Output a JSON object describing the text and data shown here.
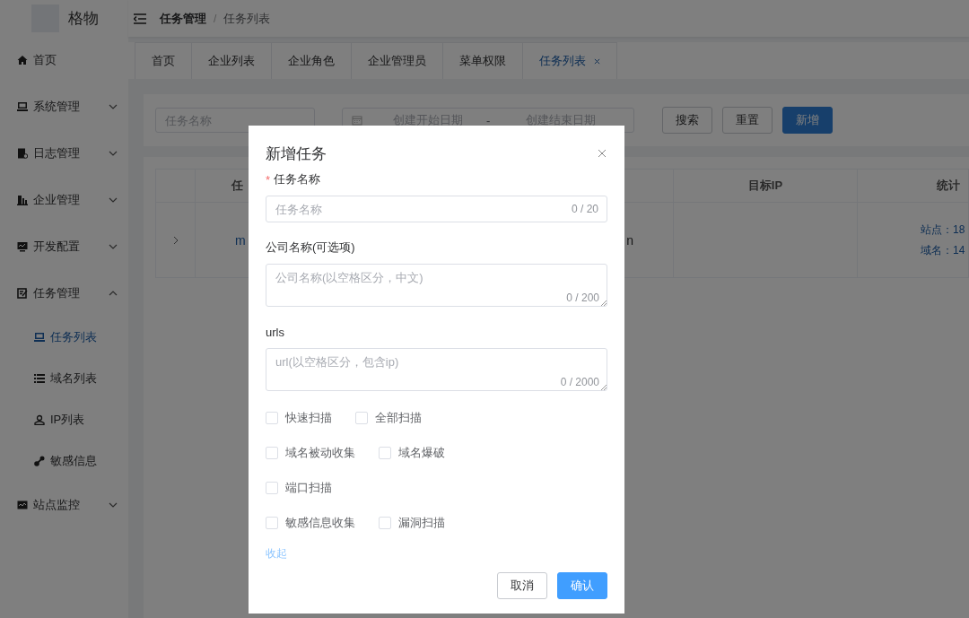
{
  "app": {
    "logo_text": "格物"
  },
  "breadcrumb": {
    "items": [
      "任务管理",
      "任务列表"
    ],
    "separator": "/"
  },
  "sidebar": {
    "items": [
      {
        "label": "首页",
        "kind": "link",
        "selected": false
      },
      {
        "label": "系统管理",
        "kind": "submenu",
        "expanded": false,
        "selected": false
      },
      {
        "label": "日志管理",
        "kind": "submenu",
        "expanded": false,
        "selected": false
      },
      {
        "label": "企业管理",
        "kind": "submenu",
        "expanded": false,
        "selected": false
      },
      {
        "label": "开发配置",
        "kind": "submenu",
        "expanded": false,
        "selected": false
      },
      {
        "label": "任务管理",
        "kind": "submenu",
        "expanded": true,
        "selected": false,
        "children": [
          {
            "label": "任务列表",
            "selected": true
          },
          {
            "label": "域名列表",
            "selected": false
          },
          {
            "label": "IP列表",
            "selected": false
          },
          {
            "label": "敏感信息",
            "selected": false
          }
        ]
      },
      {
        "label": "站点监控",
        "kind": "submenu",
        "expanded": false,
        "selected": false
      }
    ]
  },
  "tabs": [
    {
      "label": "首页",
      "selected": false,
      "closable": false
    },
    {
      "label": "企业列表",
      "selected": false,
      "closable": false
    },
    {
      "label": "企业角色",
      "selected": false,
      "closable": false
    },
    {
      "label": "企业管理员",
      "selected": false,
      "closable": false
    },
    {
      "label": "菜单权限",
      "selected": false,
      "closable": false
    },
    {
      "label": "任务列表",
      "selected": true,
      "closable": true
    }
  ],
  "search": {
    "name_placeholder": "任务名称",
    "start_placeholder": "创建开始日期",
    "separator": "-",
    "end_placeholder": "创建结束日期",
    "buttons": [
      {
        "label": "搜索",
        "kind": "default"
      },
      {
        "label": "重置",
        "kind": "default"
      },
      {
        "label": "新增",
        "kind": "primary"
      }
    ]
  },
  "table": {
    "columns": [
      "任",
      "目标IP",
      "统计"
    ],
    "rows": [
      {
        "expanded": false,
        "name_start": "m",
        "name_end": "n",
        "stats": [
          "站点：18",
          "域名：14"
        ]
      }
    ]
  },
  "dialog": {
    "title": "新增任务",
    "required_mark": "*",
    "fields": [
      {
        "kind": "input",
        "label": "任务名称",
        "required": true,
        "placeholder": "任务名称",
        "counter": "0 / 20"
      },
      {
        "kind": "textarea",
        "label": "公司名称(可选项)",
        "required": false,
        "placeholder": "公司名称(以空格区分，中文)",
        "counter": "0 / 200"
      },
      {
        "kind": "textarea",
        "label": "urls",
        "required": false,
        "placeholder": "url(以空格区分，包含ip)",
        "counter": "0 / 2000"
      }
    ],
    "option_rows": [
      [
        {
          "label": "快速扫描",
          "checked": false
        },
        {
          "label": "全部扫描",
          "checked": false
        }
      ],
      [
        {
          "label": "域名被动收集",
          "checked": false
        },
        {
          "label": "域名爆破",
          "checked": false
        }
      ],
      [
        {
          "label": "端口扫描",
          "checked": false
        }
      ],
      [
        {
          "label": "敏感信息收集",
          "checked": false
        },
        {
          "label": "漏洞扫描",
          "checked": false
        }
      ]
    ],
    "collapse_link": "收起",
    "buttons": [
      {
        "label": "取消",
        "kind": "default"
      },
      {
        "label": "确认",
        "kind": "primary"
      }
    ]
  }
}
